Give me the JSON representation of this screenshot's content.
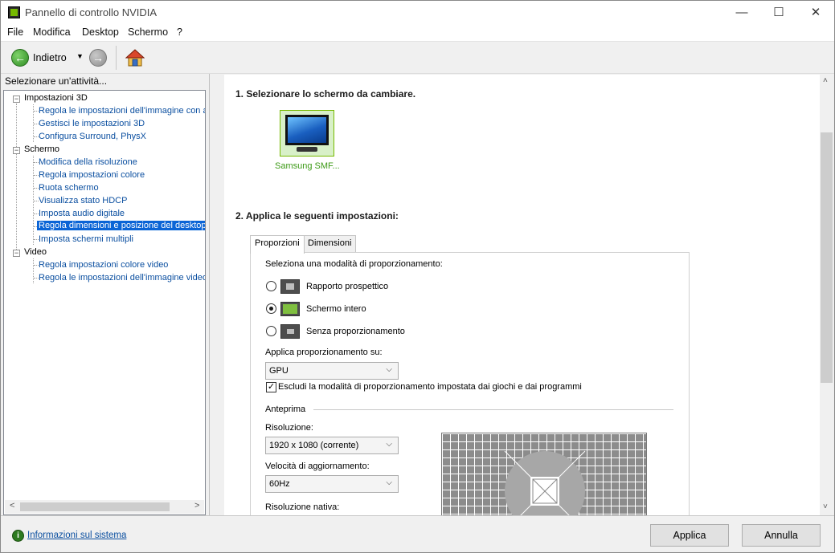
{
  "window": {
    "title": "Pannello di controllo NVIDIA",
    "minimize": "—",
    "maximize": "☐",
    "close": "✕"
  },
  "menu": [
    "File",
    "Modifica",
    "Desktop",
    "Schermo",
    "?"
  ],
  "toolbar": {
    "back_label": "Indietro",
    "back_icon": "arrow-left-icon",
    "forward_icon": "arrow-right-icon",
    "home_icon": "home-icon",
    "dropdown": "▼"
  },
  "left": {
    "header": "Selezionare un'attività...",
    "tree": [
      {
        "label": "Impostazioni 3D",
        "type": "category"
      },
      {
        "label": "Regola le impostazioni dell'immagine con an",
        "type": "item"
      },
      {
        "label": "Gestisci le impostazioni 3D",
        "type": "item"
      },
      {
        "label": "Configura Surround, PhysX",
        "type": "item"
      },
      {
        "label": "Schermo",
        "type": "category"
      },
      {
        "label": "Modifica della risoluzione",
        "type": "item"
      },
      {
        "label": "Regola impostazioni colore",
        "type": "item"
      },
      {
        "label": "Ruota schermo",
        "type": "item"
      },
      {
        "label": "Visualizza stato HDCP",
        "type": "item"
      },
      {
        "label": "Imposta audio digitale",
        "type": "item"
      },
      {
        "label": "Regola dimensioni e posizione del desktop",
        "type": "item",
        "selected": true
      },
      {
        "label": "Imposta schermi multipli",
        "type": "item"
      },
      {
        "label": "Video",
        "type": "category"
      },
      {
        "label": "Regola impostazioni colore video",
        "type": "item"
      },
      {
        "label": "Regola le impostazioni dell'immagine video",
        "type": "item"
      }
    ],
    "expander": "−",
    "scroll_left": "<",
    "scroll_right": ">"
  },
  "main": {
    "step1": "1. Selezionare lo schermo da cambiare.",
    "monitor_label": "Samsung SMF...",
    "step2": "2. Applica le seguenti impostazioni:",
    "tabs": [
      "Proporzioni",
      "Dimensioni"
    ],
    "scaling_prompt": "Seleziona una modalità di proporzionamento:",
    "scaling_options": [
      {
        "label": "Rapporto prospettico",
        "checked": false
      },
      {
        "label": "Schermo intero",
        "checked": true
      },
      {
        "label": "Senza proporzionamento",
        "checked": false
      }
    ],
    "apply_on_label": "Applica proporzionamento su:",
    "apply_on_value": "GPU",
    "override_checkbox": {
      "label": "Escludi la modalità di proporzionamento impostata dai giochi e dai programmi",
      "checked": true,
      "mark": "✓"
    },
    "preview_label": "Anteprima",
    "resolution_label": "Risoluzione:",
    "resolution_value": "1920 x 1080 (corrente)",
    "refresh_label": "Velocità di aggiornamento:",
    "refresh_value": "60Hz",
    "native_label": "Risoluzione nativa:",
    "chevron": "⌵",
    "scroll_up": "˄",
    "scroll_down": "˅"
  },
  "footer": {
    "sysinfo_label": "Informazioni sul sistema",
    "sysinfo_icon": "info-icon",
    "apply_label": "Applica",
    "cancel_label": "Annulla"
  }
}
